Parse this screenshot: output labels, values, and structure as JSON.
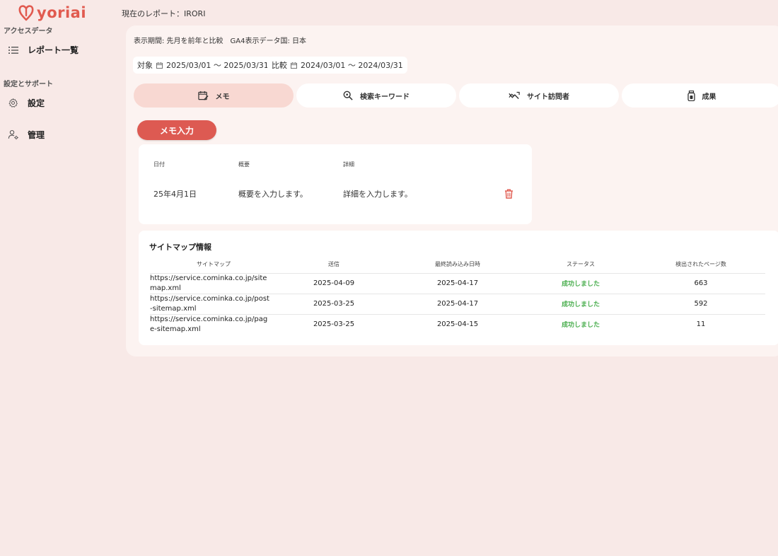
{
  "brand": {
    "name": "yoriai",
    "color": "#e15a4f"
  },
  "header": {
    "current_report": "現在のレポート：IRORI"
  },
  "sidebar": {
    "sections": [
      {
        "label": "アクセスデータ"
      },
      {
        "label": "設定とサポート"
      }
    ],
    "items": [
      {
        "label": "レポート一覧",
        "icon": "list-icon"
      },
      {
        "label": "設定",
        "icon": "gear-icon"
      },
      {
        "label": "管理",
        "icon": "user-settings-icon"
      }
    ]
  },
  "main": {
    "period_line": "表示期間: 先月を前年と比較　GA4表示データ国: 日本",
    "target": {
      "label": "対象",
      "range": "2025/03/01 〜 2025/03/31"
    },
    "compare": {
      "label": "比較",
      "range": "2024/03/01 〜 2024/03/31"
    },
    "tabs": [
      {
        "label": "メモ",
        "icon": "calendar-edit-icon",
        "active": true
      },
      {
        "label": "検索キーワード",
        "icon": "search-icon",
        "active": false
      },
      {
        "label": "サイト訪問者",
        "icon": "trend-icon",
        "active": false
      },
      {
        "label": "成果",
        "icon": "jar-icon",
        "active": false
      }
    ],
    "memo_button": "メモ入力",
    "memo_table": {
      "headers": [
        "日付",
        "概要",
        "詳細"
      ],
      "row": {
        "date": "25年4月1日",
        "summary": "概要を入力します。",
        "detail": "詳細を入力します。"
      }
    },
    "sitemap": {
      "title": "サイトマップ情報",
      "headers": [
        "サイトマップ",
        "送信",
        "最終読み込み日時",
        "ステータス",
        "検出されたページ数"
      ],
      "rows": [
        {
          "url_line1": "https://service.cominka.co.jp/site",
          "url_line2": "map.xml",
          "sent": "2025-04-09",
          "last_read": "2025-04-17",
          "status": "成功しました",
          "pages": "663"
        },
        {
          "url_line1": "https://service.cominka.co.jp/post",
          "url_line2": "-sitemap.xml",
          "sent": "2025-03-25",
          "last_read": "2025-04-17",
          "status": "成功しました",
          "pages": "592"
        },
        {
          "url_line1": "https://service.cominka.co.jp/pag",
          "url_line2": "e-sitemap.xml",
          "sent": "2025-03-25",
          "last_read": "2025-04-15",
          "status": "成功しました",
          "pages": "11"
        }
      ]
    }
  },
  "colors": {
    "accent": "#dd5a52",
    "active_tab": "#f8d8d2",
    "success": "#4caf50",
    "background": "#f8e9e7"
  }
}
